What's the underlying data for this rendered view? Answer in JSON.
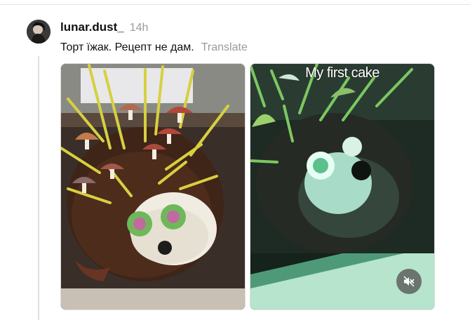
{
  "post": {
    "username": "lunar.dust_",
    "time": "14h",
    "text": "Торт їжак. Рецепт не дам.",
    "translate_label": "Translate"
  },
  "media": [
    {
      "type": "image",
      "icon": "cake-photo"
    },
    {
      "type": "video",
      "caption": "My first cake",
      "mute_icon": "speaker-muted-icon"
    }
  ]
}
